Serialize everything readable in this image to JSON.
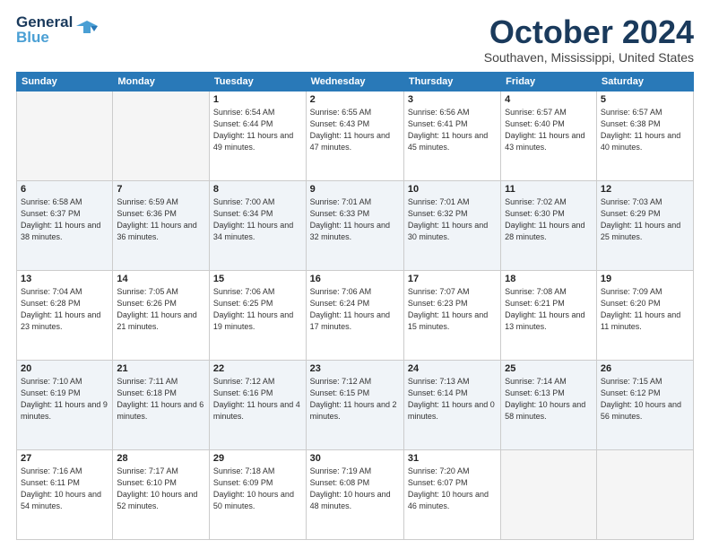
{
  "logo": {
    "line1": "General",
    "line2": "Blue",
    "accent": "Blue"
  },
  "header": {
    "month": "October 2024",
    "location": "Southaven, Mississippi, United States"
  },
  "days_of_week": [
    "Sunday",
    "Monday",
    "Tuesday",
    "Wednesday",
    "Thursday",
    "Friday",
    "Saturday"
  ],
  "weeks": [
    [
      {
        "day": "",
        "info": ""
      },
      {
        "day": "",
        "info": ""
      },
      {
        "day": "1",
        "info": "Sunrise: 6:54 AM\nSunset: 6:44 PM\nDaylight: 11 hours and 49 minutes."
      },
      {
        "day": "2",
        "info": "Sunrise: 6:55 AM\nSunset: 6:43 PM\nDaylight: 11 hours and 47 minutes."
      },
      {
        "day": "3",
        "info": "Sunrise: 6:56 AM\nSunset: 6:41 PM\nDaylight: 11 hours and 45 minutes."
      },
      {
        "day": "4",
        "info": "Sunrise: 6:57 AM\nSunset: 6:40 PM\nDaylight: 11 hours and 43 minutes."
      },
      {
        "day": "5",
        "info": "Sunrise: 6:57 AM\nSunset: 6:38 PM\nDaylight: 11 hours and 40 minutes."
      }
    ],
    [
      {
        "day": "6",
        "info": "Sunrise: 6:58 AM\nSunset: 6:37 PM\nDaylight: 11 hours and 38 minutes."
      },
      {
        "day": "7",
        "info": "Sunrise: 6:59 AM\nSunset: 6:36 PM\nDaylight: 11 hours and 36 minutes."
      },
      {
        "day": "8",
        "info": "Sunrise: 7:00 AM\nSunset: 6:34 PM\nDaylight: 11 hours and 34 minutes."
      },
      {
        "day": "9",
        "info": "Sunrise: 7:01 AM\nSunset: 6:33 PM\nDaylight: 11 hours and 32 minutes."
      },
      {
        "day": "10",
        "info": "Sunrise: 7:01 AM\nSunset: 6:32 PM\nDaylight: 11 hours and 30 minutes."
      },
      {
        "day": "11",
        "info": "Sunrise: 7:02 AM\nSunset: 6:30 PM\nDaylight: 11 hours and 28 minutes."
      },
      {
        "day": "12",
        "info": "Sunrise: 7:03 AM\nSunset: 6:29 PM\nDaylight: 11 hours and 25 minutes."
      }
    ],
    [
      {
        "day": "13",
        "info": "Sunrise: 7:04 AM\nSunset: 6:28 PM\nDaylight: 11 hours and 23 minutes."
      },
      {
        "day": "14",
        "info": "Sunrise: 7:05 AM\nSunset: 6:26 PM\nDaylight: 11 hours and 21 minutes."
      },
      {
        "day": "15",
        "info": "Sunrise: 7:06 AM\nSunset: 6:25 PM\nDaylight: 11 hours and 19 minutes."
      },
      {
        "day": "16",
        "info": "Sunrise: 7:06 AM\nSunset: 6:24 PM\nDaylight: 11 hours and 17 minutes."
      },
      {
        "day": "17",
        "info": "Sunrise: 7:07 AM\nSunset: 6:23 PM\nDaylight: 11 hours and 15 minutes."
      },
      {
        "day": "18",
        "info": "Sunrise: 7:08 AM\nSunset: 6:21 PM\nDaylight: 11 hours and 13 minutes."
      },
      {
        "day": "19",
        "info": "Sunrise: 7:09 AM\nSunset: 6:20 PM\nDaylight: 11 hours and 11 minutes."
      }
    ],
    [
      {
        "day": "20",
        "info": "Sunrise: 7:10 AM\nSunset: 6:19 PM\nDaylight: 11 hours and 9 minutes."
      },
      {
        "day": "21",
        "info": "Sunrise: 7:11 AM\nSunset: 6:18 PM\nDaylight: 11 hours and 6 minutes."
      },
      {
        "day": "22",
        "info": "Sunrise: 7:12 AM\nSunset: 6:16 PM\nDaylight: 11 hours and 4 minutes."
      },
      {
        "day": "23",
        "info": "Sunrise: 7:12 AM\nSunset: 6:15 PM\nDaylight: 11 hours and 2 minutes."
      },
      {
        "day": "24",
        "info": "Sunrise: 7:13 AM\nSunset: 6:14 PM\nDaylight: 11 hours and 0 minutes."
      },
      {
        "day": "25",
        "info": "Sunrise: 7:14 AM\nSunset: 6:13 PM\nDaylight: 10 hours and 58 minutes."
      },
      {
        "day": "26",
        "info": "Sunrise: 7:15 AM\nSunset: 6:12 PM\nDaylight: 10 hours and 56 minutes."
      }
    ],
    [
      {
        "day": "27",
        "info": "Sunrise: 7:16 AM\nSunset: 6:11 PM\nDaylight: 10 hours and 54 minutes."
      },
      {
        "day": "28",
        "info": "Sunrise: 7:17 AM\nSunset: 6:10 PM\nDaylight: 10 hours and 52 minutes."
      },
      {
        "day": "29",
        "info": "Sunrise: 7:18 AM\nSunset: 6:09 PM\nDaylight: 10 hours and 50 minutes."
      },
      {
        "day": "30",
        "info": "Sunrise: 7:19 AM\nSunset: 6:08 PM\nDaylight: 10 hours and 48 minutes."
      },
      {
        "day": "31",
        "info": "Sunrise: 7:20 AM\nSunset: 6:07 PM\nDaylight: 10 hours and 46 minutes."
      },
      {
        "day": "",
        "info": ""
      },
      {
        "day": "",
        "info": ""
      }
    ]
  ]
}
